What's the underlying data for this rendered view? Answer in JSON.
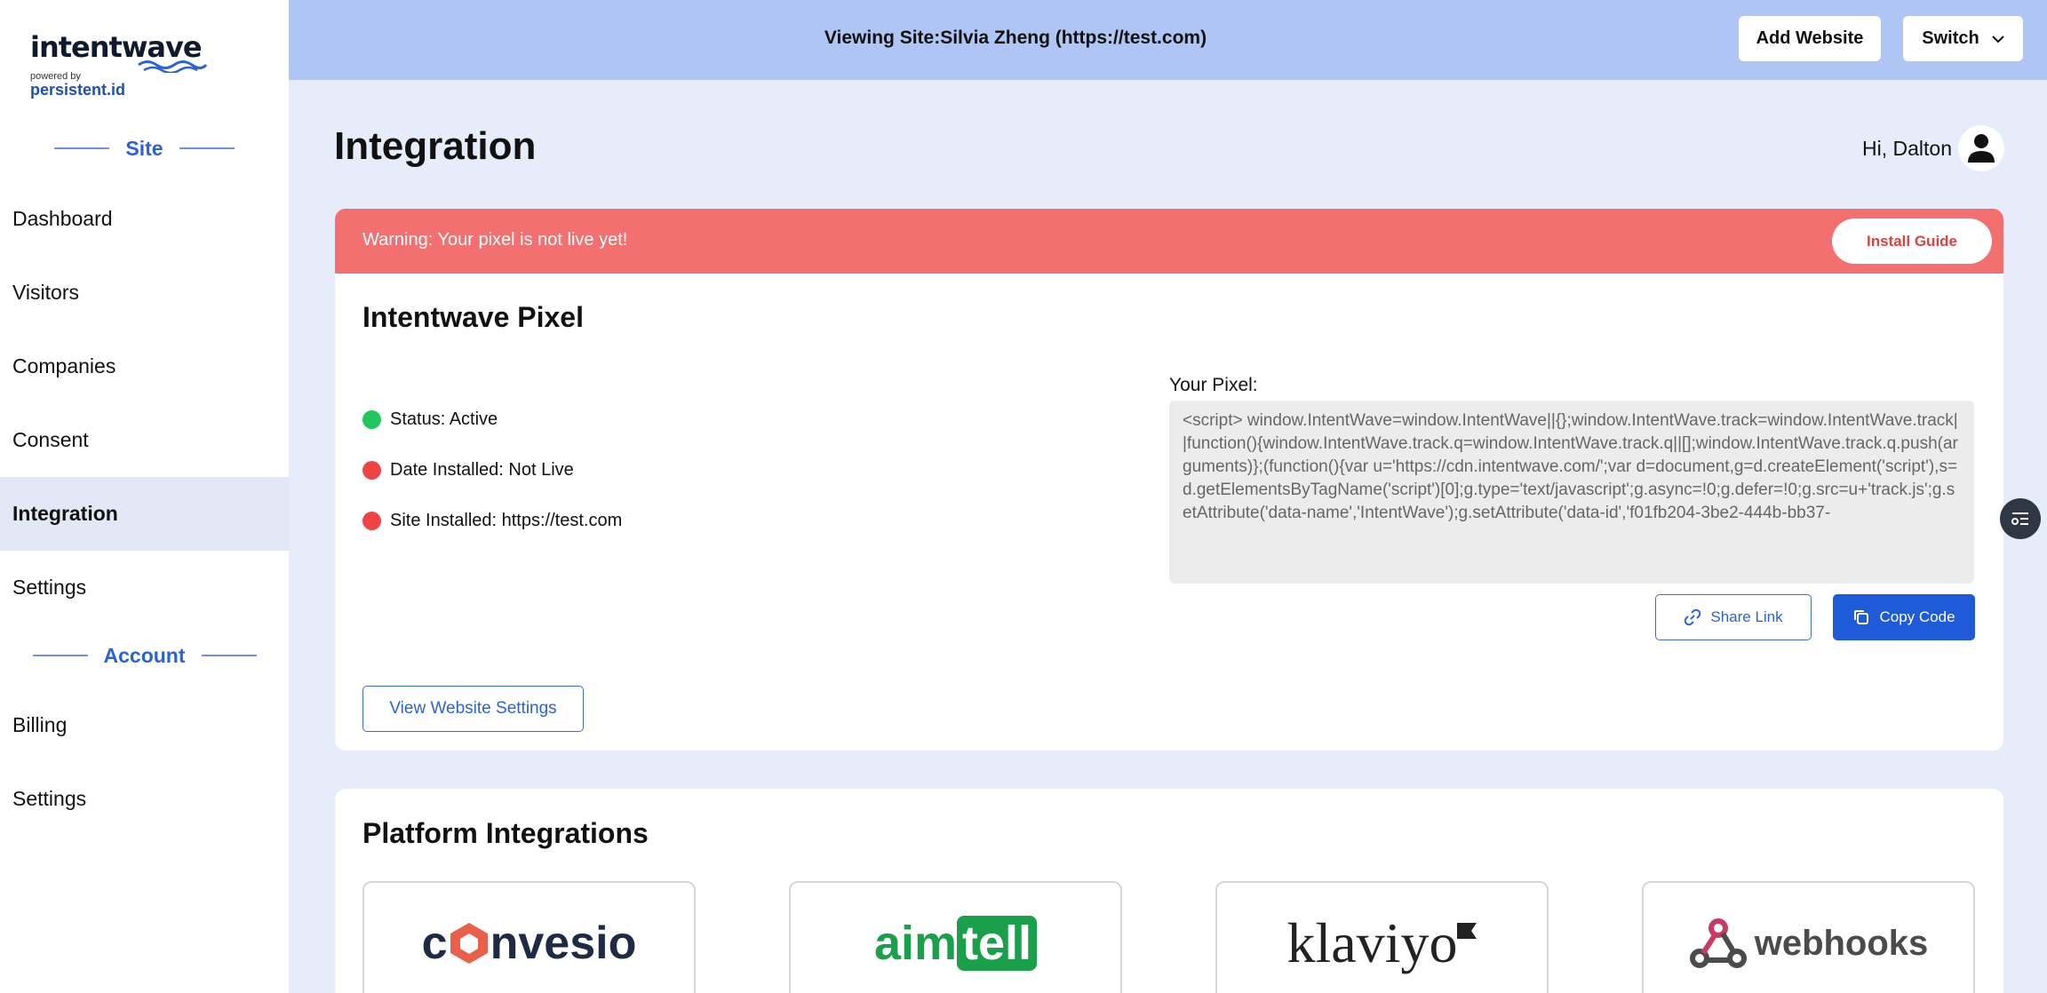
{
  "brand": {
    "name": "intentwave",
    "powered_by": "powered by",
    "sub": "persistent.id"
  },
  "sidebar": {
    "site_section": "Site",
    "site_items": [
      {
        "label": "Dashboard"
      },
      {
        "label": "Visitors"
      },
      {
        "label": "Companies"
      },
      {
        "label": "Consent"
      },
      {
        "label": "Integration"
      },
      {
        "label": "Settings"
      }
    ],
    "account_section": "Account",
    "account_items": [
      {
        "label": "Billing"
      },
      {
        "label": "Settings"
      }
    ],
    "active_item": "Integration"
  },
  "topbar": {
    "viewing": "Viewing Site:Silvia Zheng (https://test.com)",
    "add_website": "Add Website",
    "switch": "Switch"
  },
  "page": {
    "title": "Integration",
    "greeting": "Hi, Dalton"
  },
  "pixel_card": {
    "warning": "Warning: Your pixel is not live yet!",
    "install_guide": "Install Guide",
    "title": "Intentwave Pixel",
    "status": "Status: Active",
    "date_installed": "Date Installed: Not Live",
    "site_installed": "Site Installed: https://test.com",
    "your_pixel_label": "Your Pixel:",
    "code": "<script> window.IntentWave=window.IntentWave||{};window.IntentWave.track=window.IntentWave.track||function(){window.IntentWave.track.q=window.IntentWave.track.q||[];window.IntentWave.track.q.push(arguments)};(function(){var u='https://cdn.intentwave.com/';var d=document,g=d.createElement('script'),s=d.getElementsByTagName('script')[0];g.type='text/javascript';g.async=!0;g.defer=!0;g.src=u+'track.js';g.setAttribute('data-name','IntentWave');g.setAttribute('data-id','f01fb204-3be2-444b-bb37-",
    "share_link": "Share Link",
    "copy_code": "Copy Code",
    "view_settings": "View Website Settings",
    "colors": {
      "warning": "#f2706f",
      "active": "#22c55e",
      "inactive": "#ef4444",
      "primary": "#1f5bd9"
    }
  },
  "platforms": {
    "title": "Platform Integrations",
    "items": [
      {
        "name": "convesio",
        "prefix": "c",
        "suffix": "nvesio"
      },
      {
        "name": "aimtell",
        "prefix": "aim",
        "suffix": "tell"
      },
      {
        "name": "klaviyo"
      },
      {
        "name": "webhooks"
      }
    ]
  }
}
